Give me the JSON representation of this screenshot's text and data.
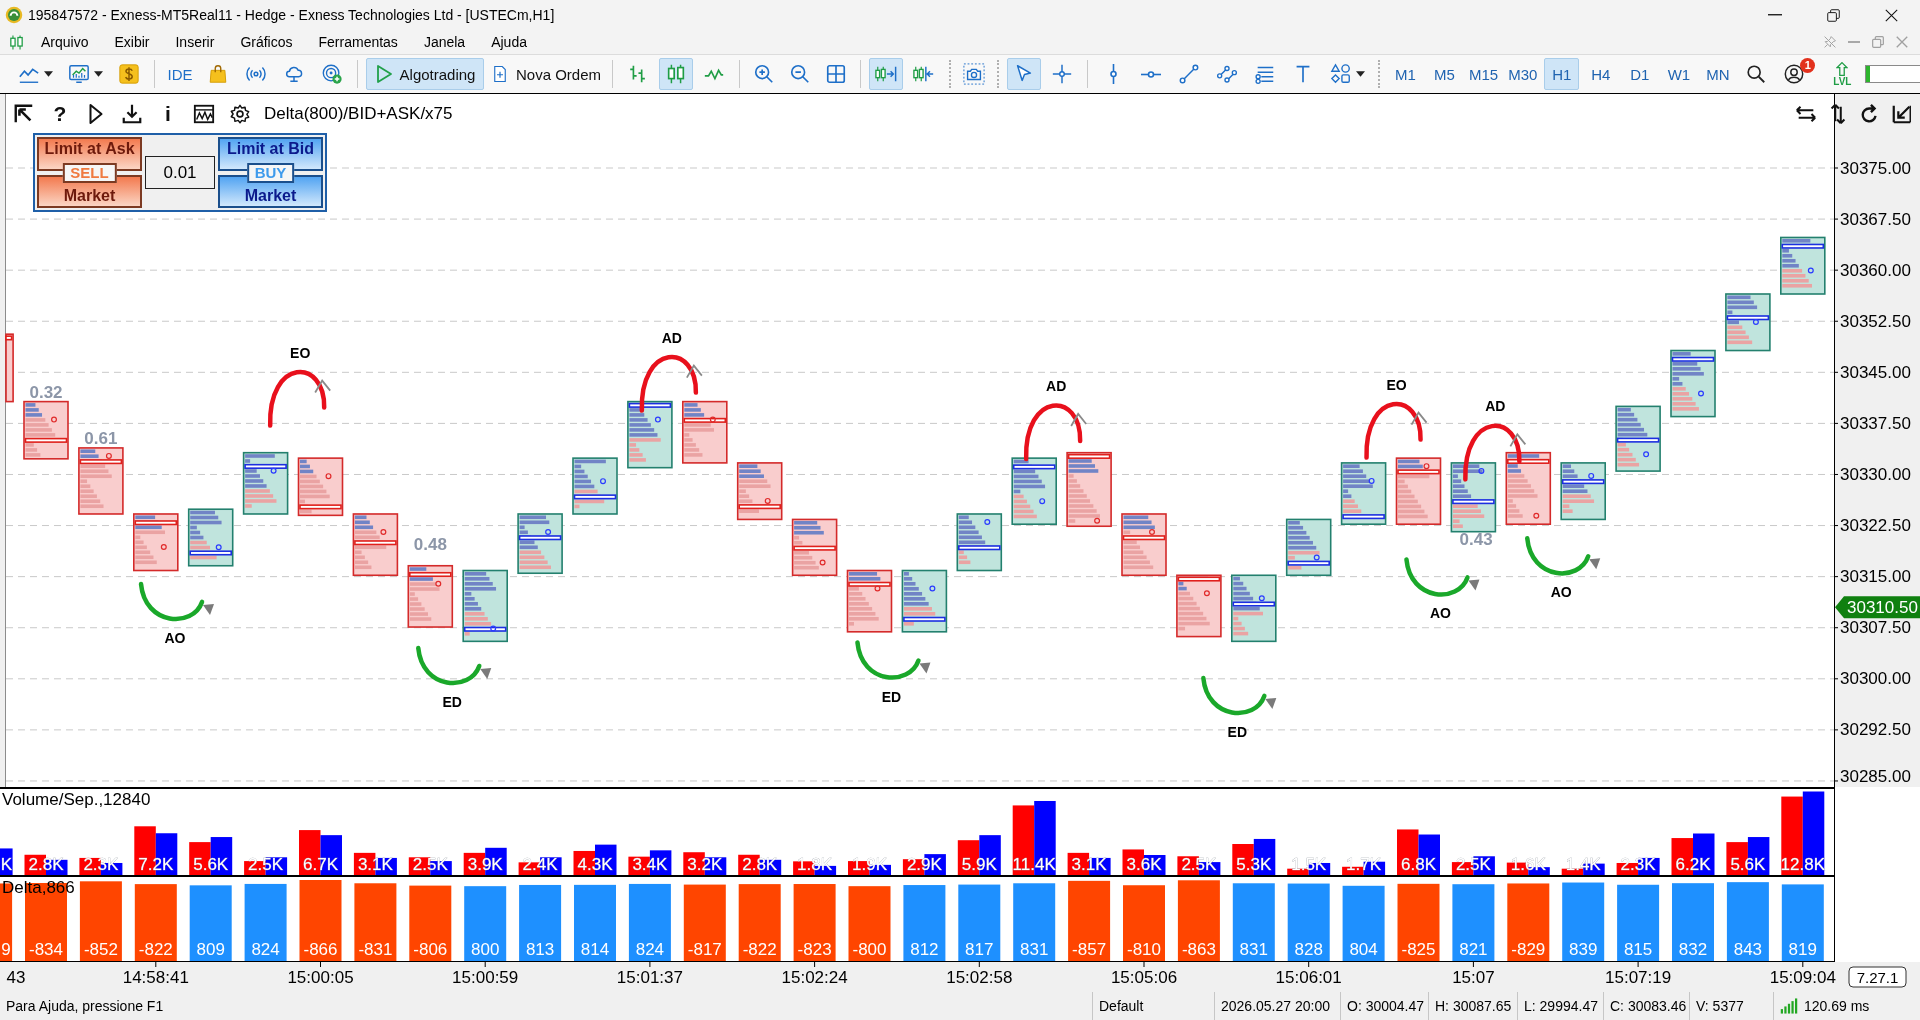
{
  "window": {
    "title": "195847572 - Exness-MT5Real11 - Hedge - Exness Technologies Ltd - [USTECm,H1]"
  },
  "menu": [
    "Arquivo",
    "Exibir",
    "Inserir",
    "Gráficos",
    "Ferramentas",
    "Janela",
    "Ajuda"
  ],
  "toolbar": {
    "ide": "IDE",
    "algotrading": {
      "label": "Algotrading",
      "on": true
    },
    "new_order": {
      "label": "Nova Ordem"
    },
    "chart_modes": [
      {
        "kind": "bars",
        "selected": false
      },
      {
        "kind": "candles",
        "selected": true
      },
      {
        "kind": "line",
        "selected": false
      }
    ],
    "chart_shift": {
      "on": true
    },
    "auto_scroll": {
      "on": false
    },
    "pointer_tools": [
      {
        "kind": "cursor",
        "selected": true
      },
      {
        "kind": "crosshair",
        "selected": false
      }
    ],
    "timeframes": [
      {
        "label": "M1",
        "selected": false
      },
      {
        "label": "M5",
        "selected": false
      },
      {
        "label": "M15",
        "selected": false
      },
      {
        "label": "M30",
        "selected": false
      },
      {
        "label": "H1",
        "selected": true
      },
      {
        "label": "H4",
        "selected": false
      },
      {
        "label": "D1",
        "selected": false
      },
      {
        "label": "W1",
        "selected": false
      },
      {
        "label": "MN",
        "selected": false
      }
    ],
    "notification_count": "1",
    "lvl": "LVL",
    "meter": {
      "level": 0.07
    }
  },
  "chart": {
    "indicator_title": "Delta(800)/BID+ASK/x75",
    "help": "?",
    "info": "i",
    "order_panel": {
      "sell_limit": "Limit at Ask",
      "sell": "SELL",
      "sell_market": "Market",
      "lots": "0.01",
      "buy_limit": "Limit at Bid",
      "buy": "BUY",
      "buy_market": "Market"
    },
    "price_scale": [
      "30375.00",
      "30367.50",
      "30360.00",
      "30352.50",
      "30345.00",
      "30337.50",
      "30330.00",
      "30322.50",
      "30315.00",
      "30307.50",
      "30300.00",
      "30292.50",
      "30285.00"
    ],
    "current_price": "30310.50",
    "marks": [
      {
        "text": "0.32",
        "kind": "ratio"
      },
      {
        "text": "0.61",
        "kind": "ratio"
      },
      {
        "text": "AO",
        "kind": "trough"
      },
      {
        "text": "EO",
        "kind": "peak"
      },
      {
        "text": "0.48",
        "kind": "ratio"
      },
      {
        "text": "ED",
        "kind": "trough"
      },
      {
        "text": "AD",
        "kind": "peak"
      },
      {
        "text": "ED",
        "kind": "trough"
      },
      {
        "text": "AD",
        "kind": "peak"
      },
      {
        "text": "ED",
        "kind": "trough"
      },
      {
        "text": "EO",
        "kind": "peak"
      },
      {
        "text": "0.43",
        "kind": "ratio"
      },
      {
        "text": "AO",
        "kind": "trough"
      },
      {
        "text": "AD",
        "kind": "peak"
      },
      {
        "text": "AO",
        "kind": "trough"
      }
    ]
  },
  "volume_panel": {
    "title": "Volume/Sep.,12840",
    "bar_labels": [
      "K",
      "2.8K",
      "2.3K",
      "7.2K",
      "5.6K",
      "2.5K",
      "6.7K",
      "3.1K",
      "2.5K",
      "3.9K",
      "2.4K",
      "4.3K",
      "3.4K",
      "3.2K",
      "2.8K",
      "1.8K",
      "1.9K",
      "2.9K",
      "5.9K",
      "11.4K",
      "3.1K",
      "3.6K",
      "2.5K",
      "5.3K",
      "1.5K",
      "1.7K",
      "6.8K",
      "2.5K",
      "1.6K",
      "1.4K",
      "2.3K",
      "6.2K",
      "5.6K",
      "12.8K"
    ]
  },
  "delta_panel": {
    "title": "Delta,866",
    "bars": [
      {
        "label": "9",
        "color": "#ff4500"
      },
      {
        "label": "-834",
        "color": "#ff4500"
      },
      {
        "label": "-852",
        "color": "#ff4500"
      },
      {
        "label": "-822",
        "color": "#ff4500"
      },
      {
        "label": "809",
        "color": "#1e90ff"
      },
      {
        "label": "824",
        "color": "#1e90ff"
      },
      {
        "label": "-866",
        "color": "#ff4500"
      },
      {
        "label": "-831",
        "color": "#ff4500"
      },
      {
        "label": "-806",
        "color": "#ff4500"
      },
      {
        "label": "800",
        "color": "#1e90ff"
      },
      {
        "label": "813",
        "color": "#1e90ff"
      },
      {
        "label": "814",
        "color": "#1e90ff"
      },
      {
        "label": "824",
        "color": "#1e90ff"
      },
      {
        "label": "-817",
        "color": "#ff4500"
      },
      {
        "label": "-822",
        "color": "#ff4500"
      },
      {
        "label": "-823",
        "color": "#ff4500"
      },
      {
        "label": "-800",
        "color": "#ff4500"
      },
      {
        "label": "812",
        "color": "#1e90ff"
      },
      {
        "label": "817",
        "color": "#1e90ff"
      },
      {
        "label": "831",
        "color": "#1e90ff"
      },
      {
        "label": "-857",
        "color": "#ff4500"
      },
      {
        "label": "-810",
        "color": "#ff4500"
      },
      {
        "label": "-863",
        "color": "#ff4500"
      },
      {
        "label": "831",
        "color": "#1e90ff"
      },
      {
        "label": "828",
        "color": "#1e90ff"
      },
      {
        "label": "804",
        "color": "#1e90ff"
      },
      {
        "label": "-825",
        "color": "#ff4500"
      },
      {
        "label": "821",
        "color": "#1e90ff"
      },
      {
        "label": "-829",
        "color": "#ff4500"
      },
      {
        "label": "839",
        "color": "#1e90ff"
      },
      {
        "label": "815",
        "color": "#1e90ff"
      },
      {
        "label": "832",
        "color": "#1e90ff"
      },
      {
        "label": "843",
        "color": "#1e90ff"
      },
      {
        "label": "819",
        "color": "#1e90ff"
      }
    ]
  },
  "time_axis": {
    "labels": [
      "43",
      "14:58:41",
      "15:00:05",
      "15:00:59",
      "15:01:37",
      "15:02:24",
      "15:02:58",
      "15:05:06",
      "15:06:01",
      "15:07",
      "15:07:19",
      "15:09:04"
    ]
  },
  "version": "7.27.1",
  "status_bar": {
    "help": "Para Ajuda, pressione F1",
    "profile": "Default",
    "datetime": "2026.05.27 20:00",
    "open": "O: 30004.47",
    "high": "H: 30087.65",
    "low": "L: 29994.47",
    "close": "C: 30083.46",
    "volume": "V: 5377",
    "ping": "120.69 ms"
  }
}
